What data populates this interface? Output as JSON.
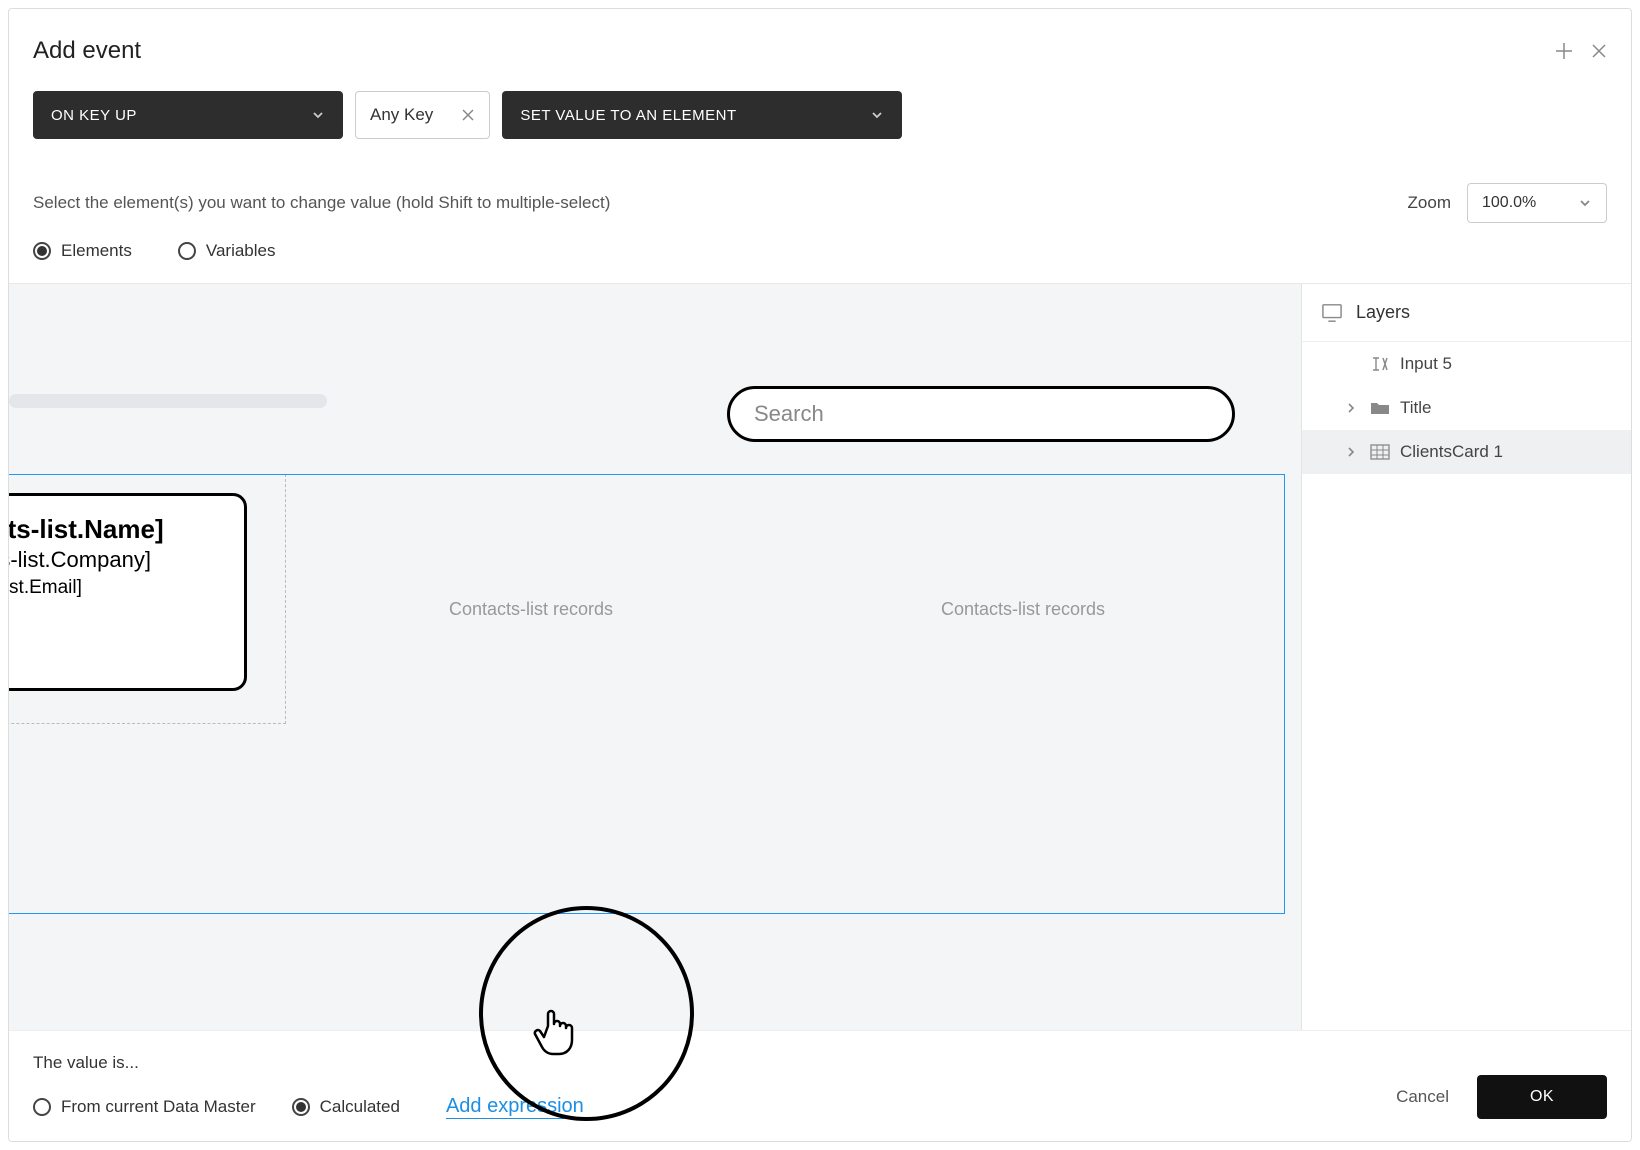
{
  "header": {
    "title": "Add event"
  },
  "selectors": {
    "trigger": "ON KEY UP",
    "key": "Any Key",
    "action": "SET VALUE TO AN ELEMENT"
  },
  "instruction": "Select the element(s) you want to change value (hold Shift to multiple-select)",
  "zoom": {
    "label": "Zoom",
    "value": "100.0%"
  },
  "target_radios": {
    "elements": "Elements",
    "variables": "Variables",
    "selected": "elements"
  },
  "canvas": {
    "search_placeholder": "Search",
    "card": {
      "line1": "tacts-list.Name]",
      "line2": "acts-list.Company]",
      "line3": "cts-list.Email]"
    },
    "placeholder_a": "Contacts-list records",
    "placeholder_b": "Contacts-list records"
  },
  "layers": {
    "title": "Layers",
    "items": [
      {
        "label": "Input 5",
        "icon": "text",
        "expandable": false,
        "selected": false
      },
      {
        "label": "Title",
        "icon": "folder",
        "expandable": true,
        "selected": false
      },
      {
        "label": "ClientsCard 1",
        "icon": "grid",
        "expandable": true,
        "selected": true
      }
    ]
  },
  "footer": {
    "value_label": "The value is...",
    "from_data_master": "From current Data Master",
    "calculated": "Calculated",
    "selected": "calculated",
    "add_expression": "Add expression",
    "cancel": "Cancel",
    "ok": "OK"
  }
}
